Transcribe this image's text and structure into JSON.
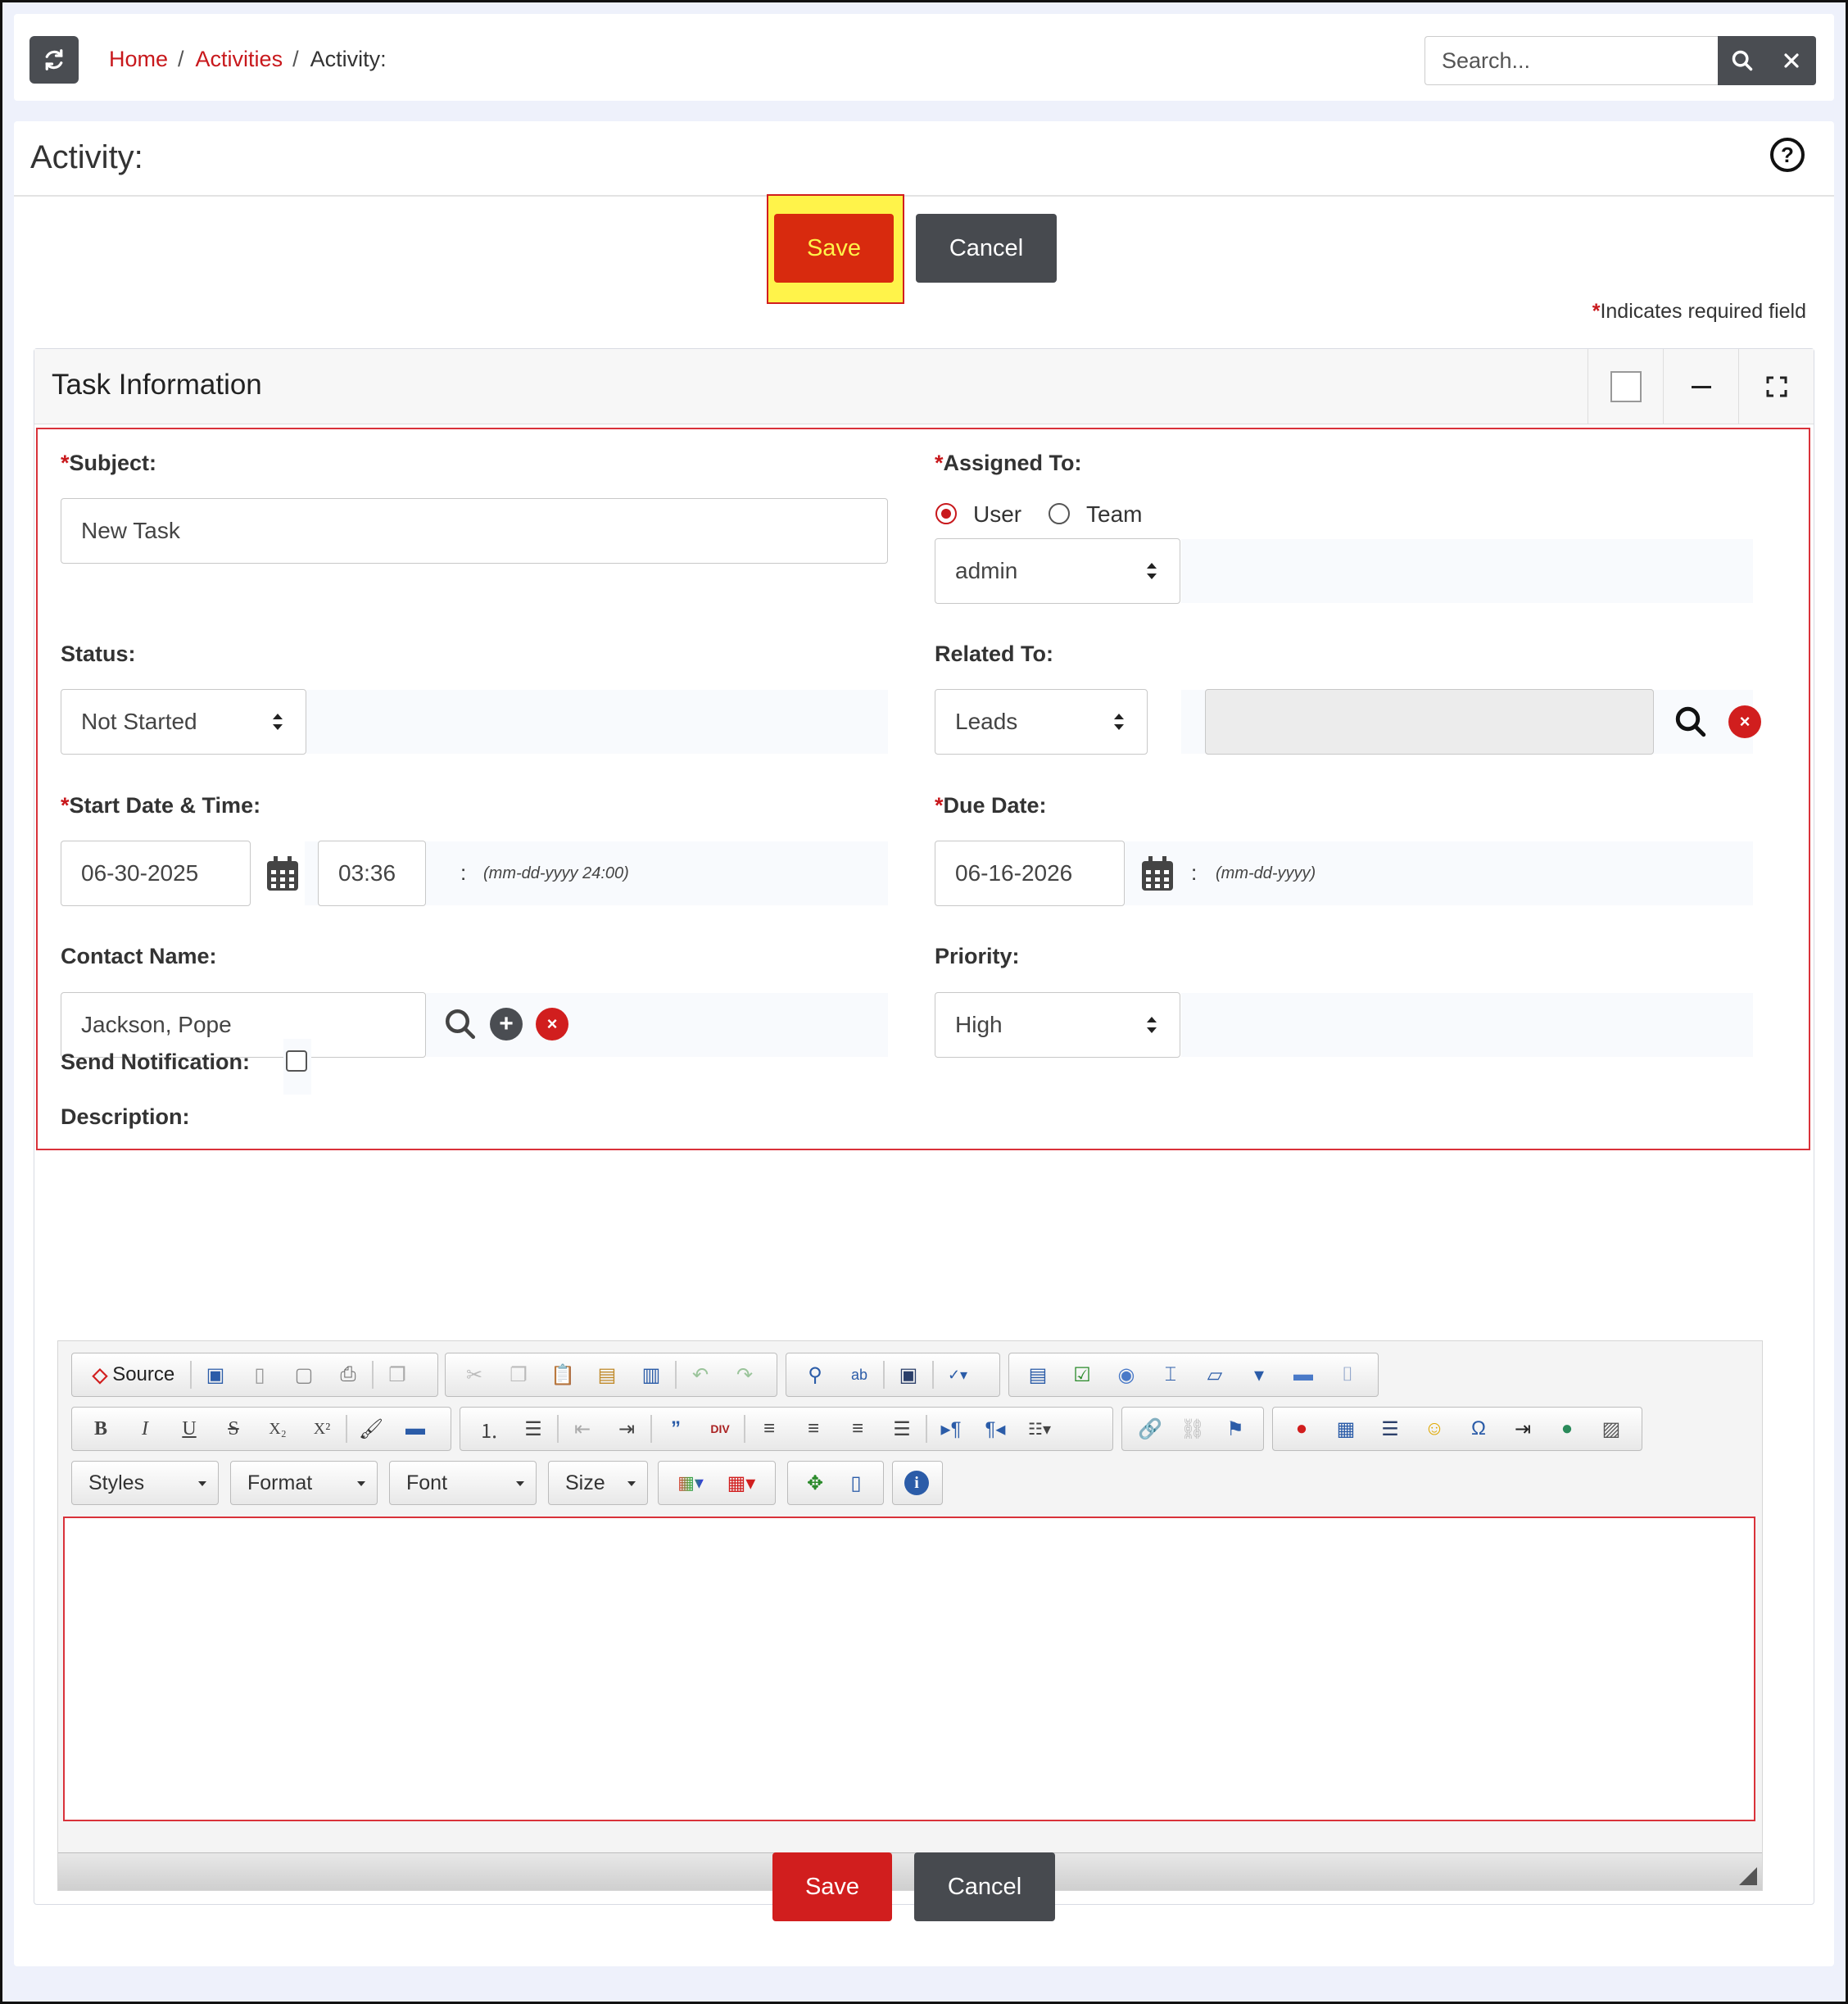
{
  "breadcrumb": {
    "home": "Home",
    "activities": "Activities",
    "current": "Activity:",
    "sep": "/"
  },
  "search": {
    "placeholder": "Search..."
  },
  "page": {
    "title": "Activity:",
    "help": "?"
  },
  "actions": {
    "save": "Save",
    "cancel": "Cancel"
  },
  "required_note": {
    "star": "*",
    "text": "Indicates required field"
  },
  "section": {
    "title": "Task Information"
  },
  "fields": {
    "subject": {
      "label": "Subject:",
      "value": "New Task",
      "required": "*"
    },
    "assigned_to": {
      "label": "Assigned To:",
      "required": "*",
      "option_user": "User",
      "option_team": "Team",
      "value": "admin"
    },
    "status": {
      "label": "Status:",
      "value": "Not Started"
    },
    "related_to": {
      "label": "Related To:",
      "value": "Leads"
    },
    "start": {
      "label": "Start Date & Time:",
      "required": "*",
      "date": "06-30-2025",
      "time": "03:36",
      "colon": ":",
      "hint": "(mm-dd-yyyy 24:00)"
    },
    "due": {
      "label": "Due Date:",
      "required": "*",
      "date": "06-16-2026",
      "colon": ":",
      "hint": "(mm-dd-yyyy)"
    },
    "contact": {
      "label": "Contact Name:",
      "value": "Jackson, Pope"
    },
    "priority": {
      "label": "Priority:",
      "value": "High"
    },
    "notify": {
      "label": "Send Notification:"
    },
    "description": {
      "label": "Description:"
    }
  },
  "editor": {
    "source": "Source",
    "combos": {
      "styles": "Styles",
      "format": "Format",
      "font": "Font",
      "size": "Size"
    },
    "bold": "B",
    "italic": "I",
    "underline": "U",
    "strike": "S",
    "sub": "X₂",
    "sup": "X²",
    "omega": "Ω",
    "info": "i"
  },
  "colors": {
    "accent": "#d11e1e",
    "dark_button": "#474a4f",
    "highlight": "#fff34a"
  }
}
